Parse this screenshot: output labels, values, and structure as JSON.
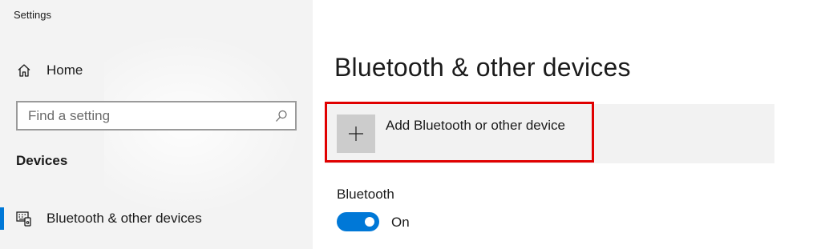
{
  "window": {
    "title": "Settings"
  },
  "sidebar": {
    "home_label": "Home",
    "home_icon": "home-icon",
    "search": {
      "placeholder": "Find a setting",
      "value": "",
      "icon": "search-icon"
    },
    "section_heading": "Devices",
    "items": [
      {
        "label": "Bluetooth & other devices",
        "icon": "bluetooth-devices-icon",
        "selected": true
      }
    ]
  },
  "main": {
    "title": "Bluetooth & other devices",
    "add_device": {
      "label": "Add Bluetooth or other device",
      "icon": "plus-icon"
    },
    "bluetooth": {
      "label": "Bluetooth",
      "toggle_state": "On",
      "enabled": true
    }
  },
  "colors": {
    "accent": "#0078d7",
    "highlight": "#e00000",
    "sidebar_bg": "#f3f3f3",
    "tile_bg": "#cccccc"
  }
}
